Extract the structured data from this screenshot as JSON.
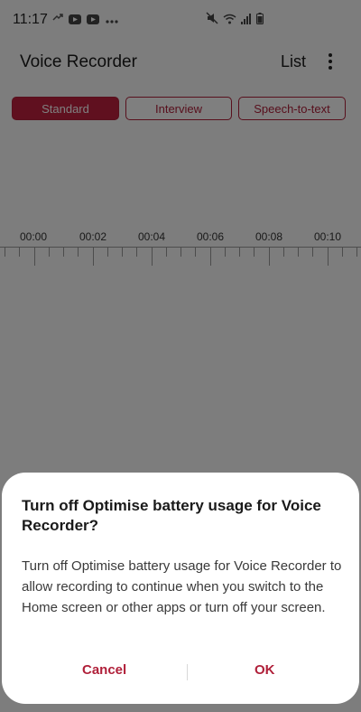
{
  "status_bar": {
    "time": "11:17",
    "notification_icons": [
      "phone-missed-icon",
      "youtube-icon",
      "youtube-icon",
      "more-notifications-icon"
    ],
    "system_icons": [
      "mute-icon",
      "wifi-icon",
      "signal-icon",
      "battery-icon"
    ]
  },
  "appbar": {
    "title": "Voice Recorder",
    "list_label": "List"
  },
  "modes": [
    {
      "label": "Standard",
      "active": true
    },
    {
      "label": "Interview",
      "active": false
    },
    {
      "label": "Speech-to-text",
      "active": false
    }
  ],
  "timeline": {
    "labels": [
      "00:00",
      "00:02",
      "00:04",
      "00:06",
      "00:08",
      "00:10"
    ]
  },
  "dialog": {
    "title": "Turn off Optimise battery usage for Voice Recorder?",
    "body": "Turn off Optimise battery usage for Voice Recorder to allow recording to continue when you switch to the Home screen or other apps or turn off your screen.",
    "cancel_label": "Cancel",
    "ok_label": "OK"
  },
  "colors": {
    "accent": "#c0213e",
    "scrim": "rgba(0,0,0,0.5)"
  }
}
